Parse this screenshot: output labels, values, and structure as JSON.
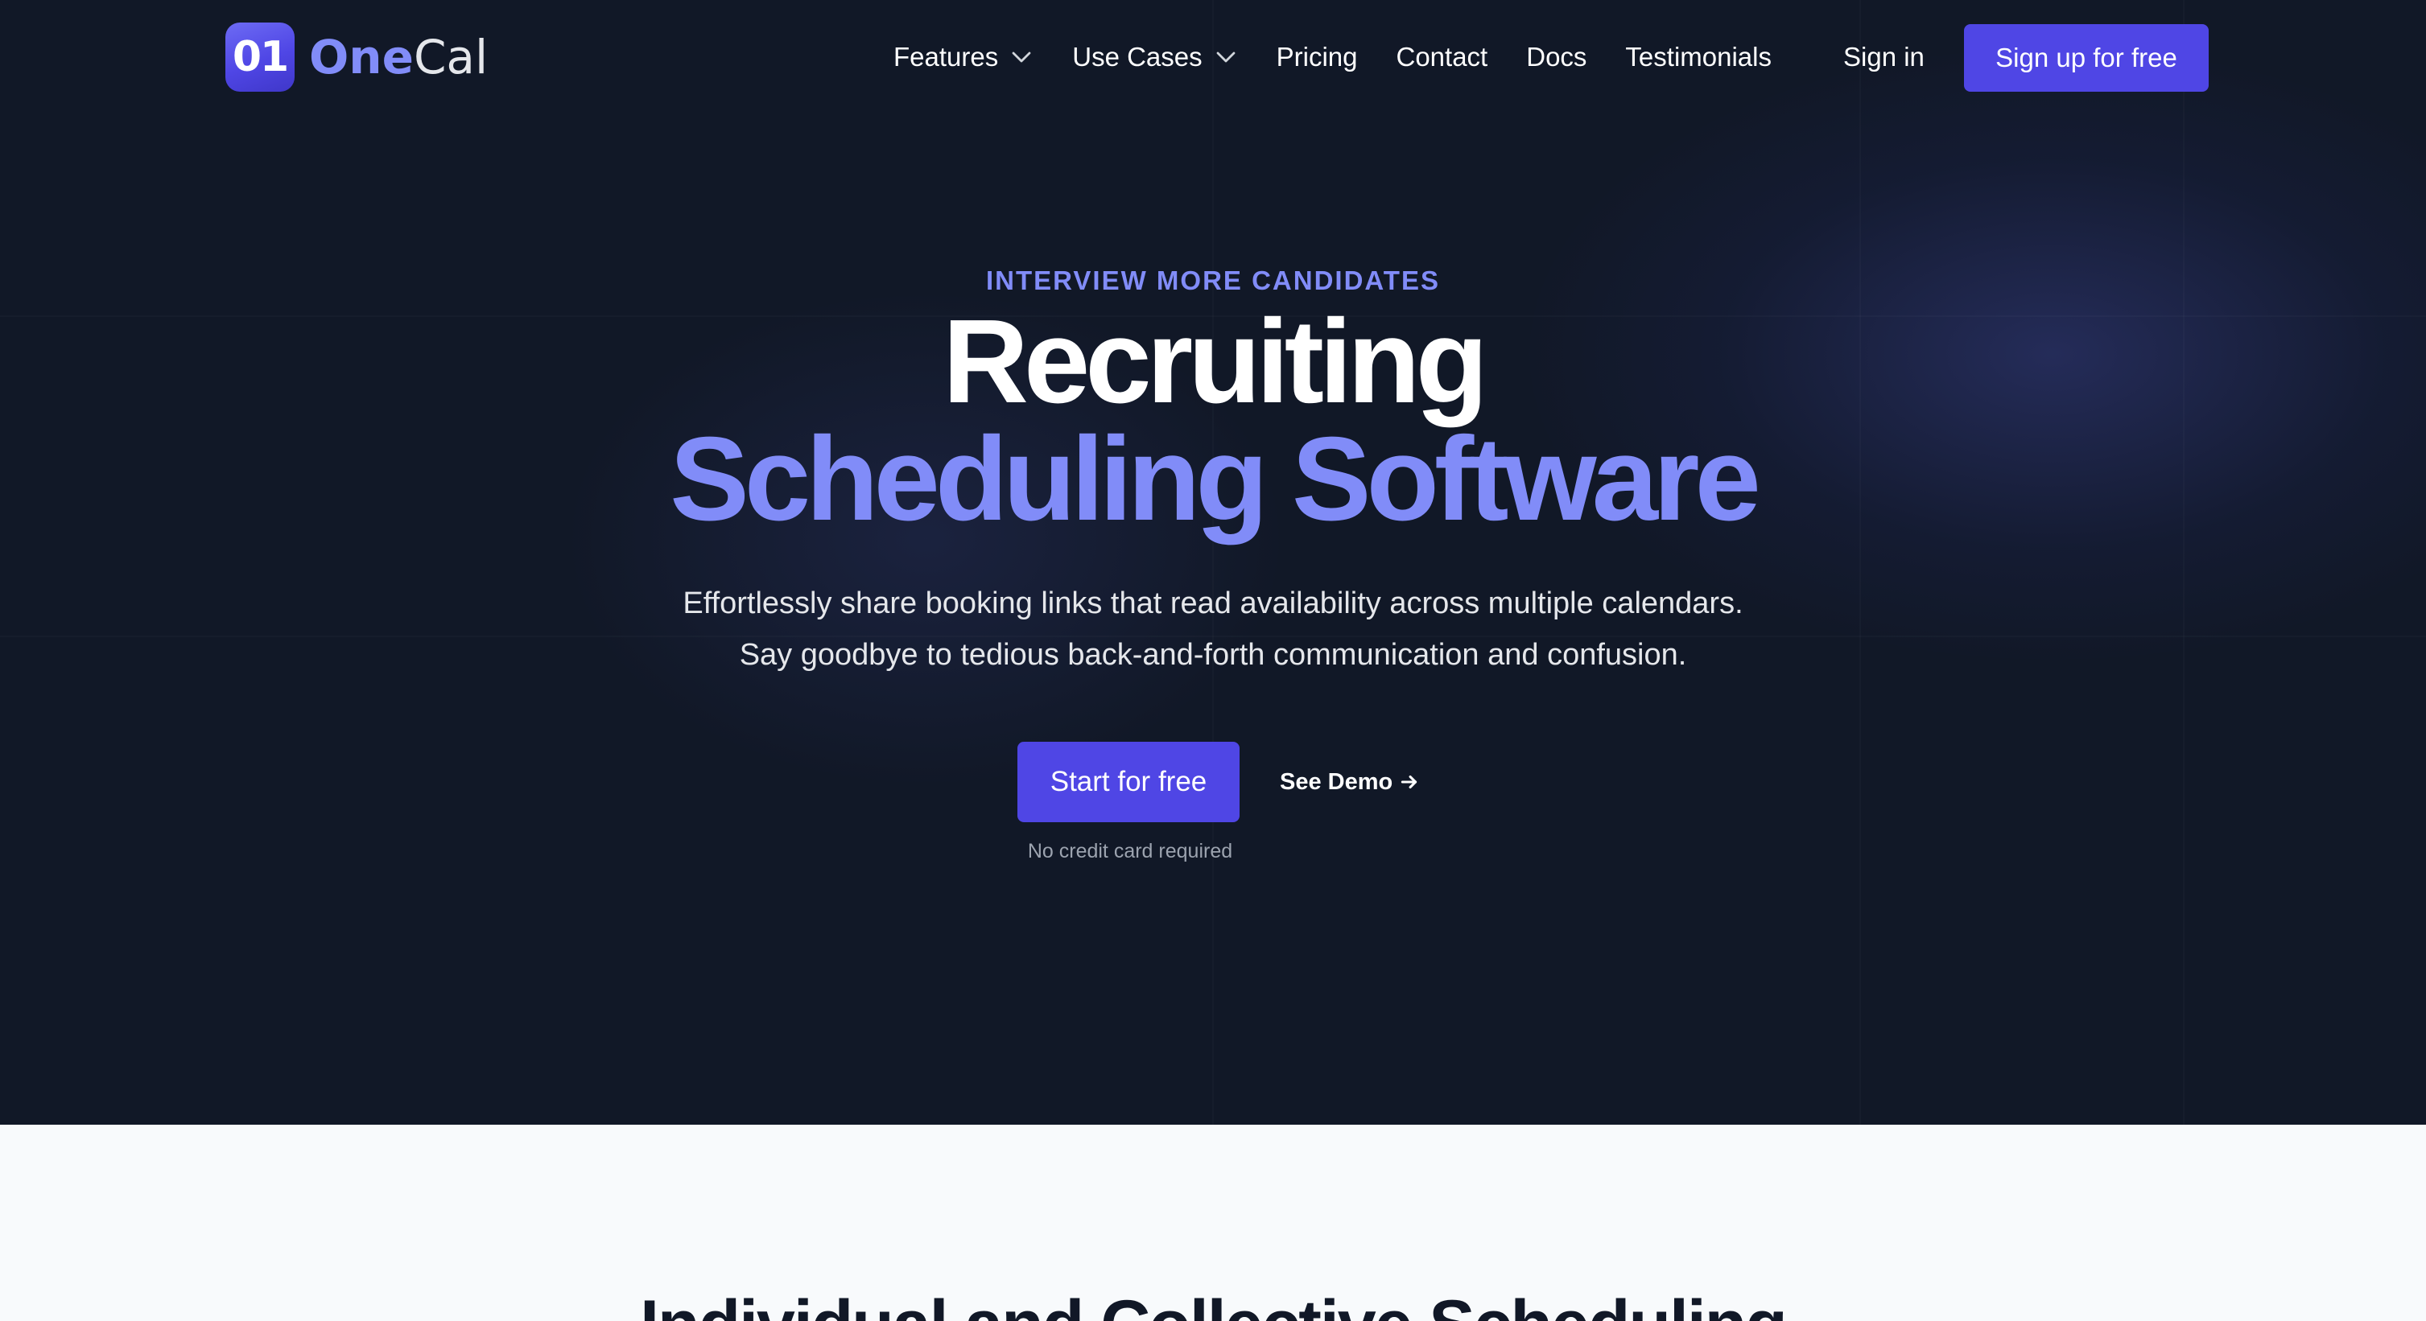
{
  "brand": {
    "logo_mark": "01",
    "name_part1": "One",
    "name_part2": "Cal"
  },
  "nav": {
    "items": [
      {
        "label": "Features",
        "has_dropdown": true
      },
      {
        "label": "Use Cases",
        "has_dropdown": true
      },
      {
        "label": "Pricing",
        "has_dropdown": false
      },
      {
        "label": "Contact",
        "has_dropdown": false
      },
      {
        "label": "Docs",
        "has_dropdown": false
      },
      {
        "label": "Testimonials",
        "has_dropdown": false
      }
    ],
    "sign_in": "Sign in",
    "sign_up": "Sign up for free"
  },
  "hero": {
    "eyebrow": "INTERVIEW MORE CANDIDATES",
    "title_line1": "Recruiting",
    "title_line2": "Scheduling Software",
    "subtitle_line1": "Effortlessly share booking links that read availability across multiple calendars.",
    "subtitle_line2": "Say goodbye to tedious back-and-forth communication and confusion.",
    "cta_primary": "Start for free",
    "cta_secondary": "See Demo",
    "note": "No credit card required"
  },
  "section2": {
    "title": "Individual and Collective Scheduling"
  },
  "icons": {
    "dropdown": "chevron-down-icon",
    "demo_arrow": "arrow-right-icon"
  },
  "colors": {
    "hero_bg": "#111827",
    "accent": "#4f46e5",
    "accent_light": "#818cf8",
    "section_bg": "#f8fafc"
  }
}
